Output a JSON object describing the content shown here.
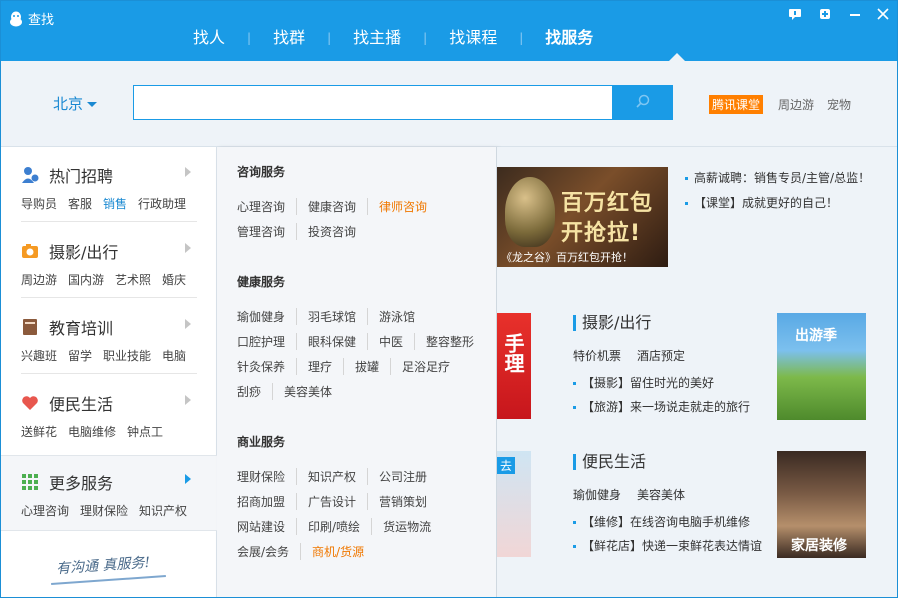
{
  "window": {
    "title": "查找",
    "btn_feedback": "✉",
    "btn_menu": "⊞",
    "btn_min": "—",
    "btn_close": "✕"
  },
  "tabs": [
    {
      "label": "找人"
    },
    {
      "label": "找群"
    },
    {
      "label": "找主播"
    },
    {
      "label": "找课程"
    },
    {
      "label": "找服务",
      "active": true
    }
  ],
  "search": {
    "city": "北京",
    "value": "",
    "placeholder": "",
    "badge": "腾讯课堂",
    "quick_links": [
      "周边游",
      "宠物"
    ]
  },
  "sidebar": {
    "categories": [
      {
        "title": "热门招聘",
        "icon": "recruit-icon",
        "subs": [
          "导购员",
          "客服",
          "销售",
          "行政助理"
        ],
        "highlight": "销售"
      },
      {
        "title": "摄影/出行",
        "icon": "camera-icon",
        "subs": [
          "周边游",
          "国内游",
          "艺术照",
          "婚庆"
        ]
      },
      {
        "title": "教育培训",
        "icon": "book-icon",
        "subs": [
          "兴趣班",
          "留学",
          "职业技能",
          "电脑"
        ]
      },
      {
        "title": "便民生活",
        "icon": "heart-icon",
        "subs": [
          "送鲜花",
          "电脑维修",
          "钟点工"
        ]
      },
      {
        "title": "更多服务",
        "icon": "grid-icon",
        "subs": [
          "心理咨询",
          "理财保险",
          "知识产权"
        ]
      }
    ],
    "slogan": "有沟通 真服务!"
  },
  "flyout": {
    "sections": [
      {
        "title": "咨询服务",
        "rows": [
          [
            "心理咨询",
            "健康咨询",
            "律师咨询"
          ],
          [
            "管理咨询",
            "投资咨询"
          ]
        ],
        "orange": [
          "律师咨询"
        ]
      },
      {
        "title": "健康服务",
        "rows": [
          [
            "瑜伽健身",
            "羽毛球馆",
            "游泳馆"
          ],
          [
            "口腔护理",
            "眼科保健",
            "中医",
            "整容整形"
          ],
          [
            "针灸保养",
            "理疗",
            "拔罐",
            "足浴足疗"
          ],
          [
            "刮痧",
            "美容美体"
          ]
        ],
        "orange": []
      },
      {
        "title": "商业服务",
        "rows": [
          [
            "理财保险",
            "知识产权",
            "公司注册"
          ],
          [
            "招商加盟",
            "广告设计",
            "营销策划"
          ],
          [
            "网站建设",
            "印刷/喷绘",
            "货运物流"
          ],
          [
            "会展/会务",
            "商机/货源"
          ]
        ],
        "orange": [
          "商机/货源"
        ]
      }
    ]
  },
  "content": {
    "banner": {
      "line1": "百万红包",
      "line2": "开抢拉!",
      "caption": "《龙之谷》百万红包开抢！"
    },
    "news": [
      "高薪诚聘：销售专员/主管/总监！",
      "【课堂】成就更好的自己！"
    ],
    "photo": {
      "title": "摄影/出行",
      "links": [
        "特价机票",
        "酒店预定"
      ],
      "news": [
        "【摄影】留住时光的美好",
        "【旅游】来一场说走就走的旅行"
      ],
      "thumb_caption": "出游季"
    },
    "life": {
      "title": "便民生活",
      "links": [
        "瑜伽健身",
        "美容美体"
      ],
      "news": [
        "【维修】在线咨询电脑手机维修",
        "【鲜花店】快递一束鲜花表达情谊"
      ],
      "thumb_caption": "家居装修"
    },
    "sliver1_text": "手理",
    "sliver2_text": "去"
  },
  "colors": {
    "accent": "#1a9be6",
    "orange": "#f07800",
    "badge": "#ff7f00"
  }
}
